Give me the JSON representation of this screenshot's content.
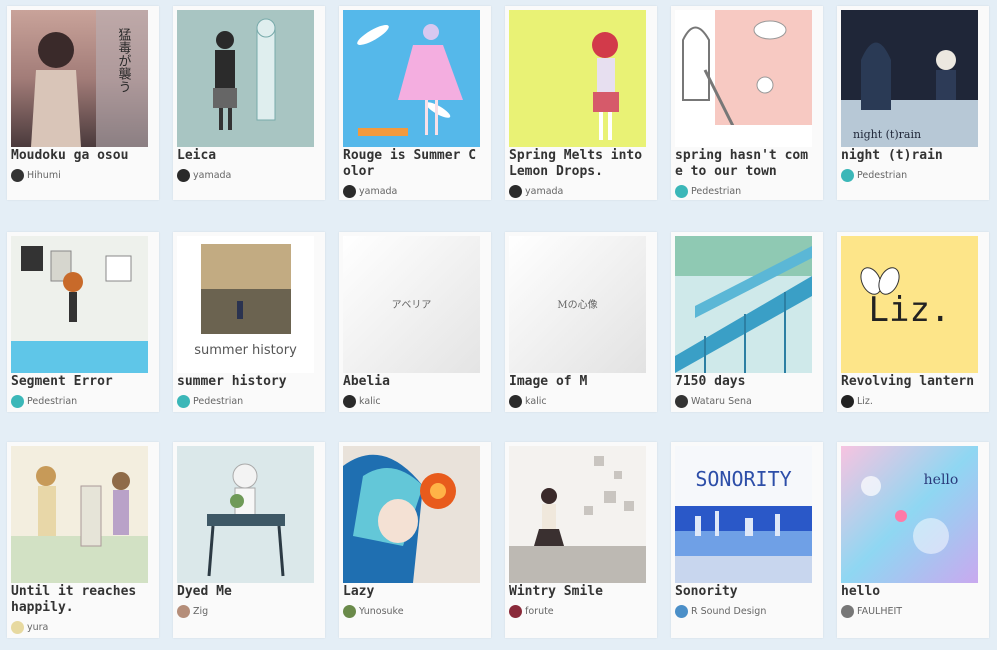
{
  "cards": [
    {
      "title": "Moudoku ga osou",
      "artist": "Hihumi",
      "thumb_text": "猛毒が襲う"
    },
    {
      "title": "Leica",
      "artist": "yamada"
    },
    {
      "title": "Rouge is Summer Color",
      "artist": "yamada"
    },
    {
      "title": "Spring Melts into Lemon Drops.",
      "artist": "yamada"
    },
    {
      "title": "spring hasn't come to our town",
      "artist": "Pedestrian"
    },
    {
      "title": "night (t)rain",
      "artist": "Pedestrian",
      "thumb_text": "night (t)rain"
    },
    {
      "title": "Segment Error",
      "artist": "Pedestrian"
    },
    {
      "title": "summer history",
      "artist": "Pedestrian",
      "thumb_text": "summer history"
    },
    {
      "title": "Abelia",
      "artist": "kalic",
      "thumb_text": "アベリア"
    },
    {
      "title": "Image of M",
      "artist": "kalic",
      "thumb_text": "Mの心像"
    },
    {
      "title": "7150 days",
      "artist": "Wataru Sena"
    },
    {
      "title": "Revolving lantern",
      "artist": "Liz.",
      "thumb_text": "Liz."
    },
    {
      "title": "Until it reaches happily.",
      "artist": "yura"
    },
    {
      "title": "Dyed Me",
      "artist": "Zig"
    },
    {
      "title": "Lazy",
      "artist": "Yunosuke"
    },
    {
      "title": "Wintry Smile",
      "artist": "forute"
    },
    {
      "title": "Sonority",
      "artist": "R Sound Design",
      "thumb_text": "SONORITY"
    },
    {
      "title": "hello",
      "artist": "FAULHEIT",
      "thumb_text": "hello"
    }
  ]
}
